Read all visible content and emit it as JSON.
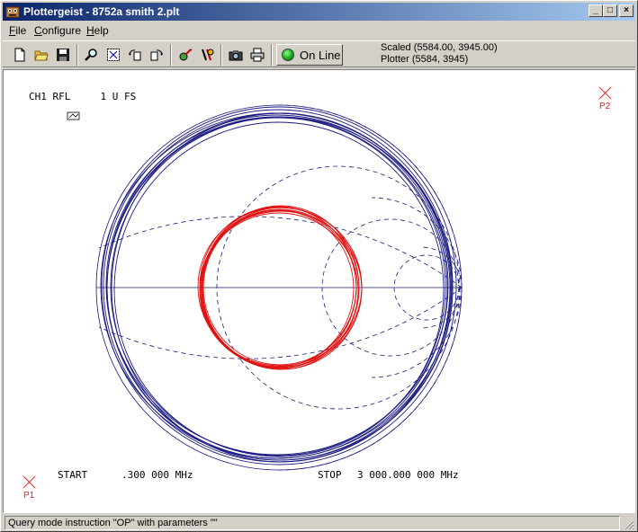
{
  "window": {
    "title": "Plottergeist - 8752a smith 2.plt"
  },
  "menu": {
    "items": [
      {
        "accel": "F",
        "rest": "ile"
      },
      {
        "accel": "C",
        "rest": "onfigure"
      },
      {
        "accel": "H",
        "rest": "elp"
      }
    ]
  },
  "toolbar": {
    "online_label": "On Line",
    "scaled": "Scaled (5584.00, 3945.00)",
    "plotter": "Plotter (5584, 3945)"
  },
  "plot": {
    "header": "CH1 RFL     1 U FS",
    "p1_label": "P1",
    "p2_label": "P2",
    "start_label": "START",
    "start_value": ".300 000 MHz",
    "stop_label": "STOP",
    "stop_value": "3 000.000 000 MHz",
    "colors": {
      "trace_outer": "#1a1a80",
      "trace_inner": "#e01010",
      "marker": "#e02020"
    }
  },
  "status": {
    "text": "Query mode instruction \"OP\" with parameters \"\""
  }
}
